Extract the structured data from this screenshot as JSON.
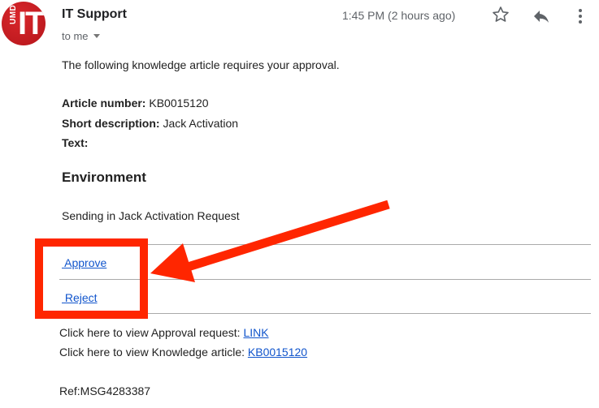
{
  "header": {
    "sender": "IT Support",
    "avatar": {
      "top_text": "UMD",
      "main_text": "IT",
      "color": "#c8191e"
    },
    "recipient": "to me",
    "timestamp": "1:45 PM (2 hours ago)",
    "icons": {
      "star": "star-icon",
      "reply": "reply-icon",
      "more": "more-vert-icon"
    }
  },
  "body": {
    "intro": "The following knowledge article requires your approval.",
    "fields": [
      {
        "label": "Article number:",
        "value": " KB0015120"
      },
      {
        "label": "Short description:",
        "value": " Jack Activation"
      },
      {
        "label": "Text:",
        "value": ""
      }
    ],
    "section_heading": "Environment",
    "section_text": "Sending in Jack Activation Request",
    "actions": {
      "approve": " Approve",
      "reject": " Reject"
    },
    "links": [
      {
        "text": "Click here to view Approval request: ",
        "link": "LINK"
      },
      {
        "text": "Click here to view Knowledge article: ",
        "link": "KB0015120"
      }
    ],
    "ref": "Ref:MSG4283387"
  },
  "annotation": {
    "color": "#ff2600"
  }
}
